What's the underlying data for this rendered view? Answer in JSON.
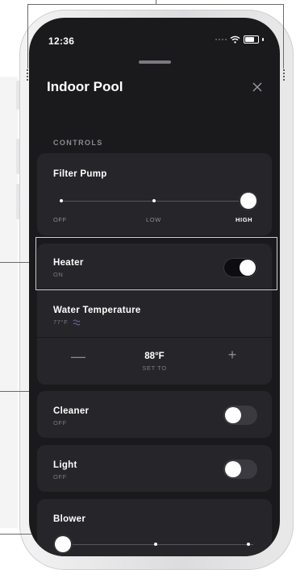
{
  "status_bar": {
    "time": "12:36"
  },
  "sheet": {
    "title": "Indoor Pool",
    "section": "CONTROLS"
  },
  "filter_pump": {
    "title": "Filter Pump",
    "stops": [
      "OFF",
      "LOW",
      "HIGH"
    ],
    "selected": "HIGH"
  },
  "heater": {
    "title": "Heater",
    "status": "ON",
    "toggle_on": true
  },
  "water_temperature": {
    "title": "Water Temperature",
    "current": "77°F",
    "setpoint": "88°F",
    "setpoint_label": "SET TO",
    "decrease": "—",
    "increase": "+"
  },
  "cleaner": {
    "title": "Cleaner",
    "status": "OFF",
    "toggle_on": false
  },
  "light": {
    "title": "Light",
    "status": "OFF",
    "toggle_on": false
  },
  "blower": {
    "title": "Blower"
  },
  "colors": {
    "background": "#1a1a1c",
    "card": "#26262a",
    "accent": "#ffffff",
    "muted": "#8c8c92"
  }
}
